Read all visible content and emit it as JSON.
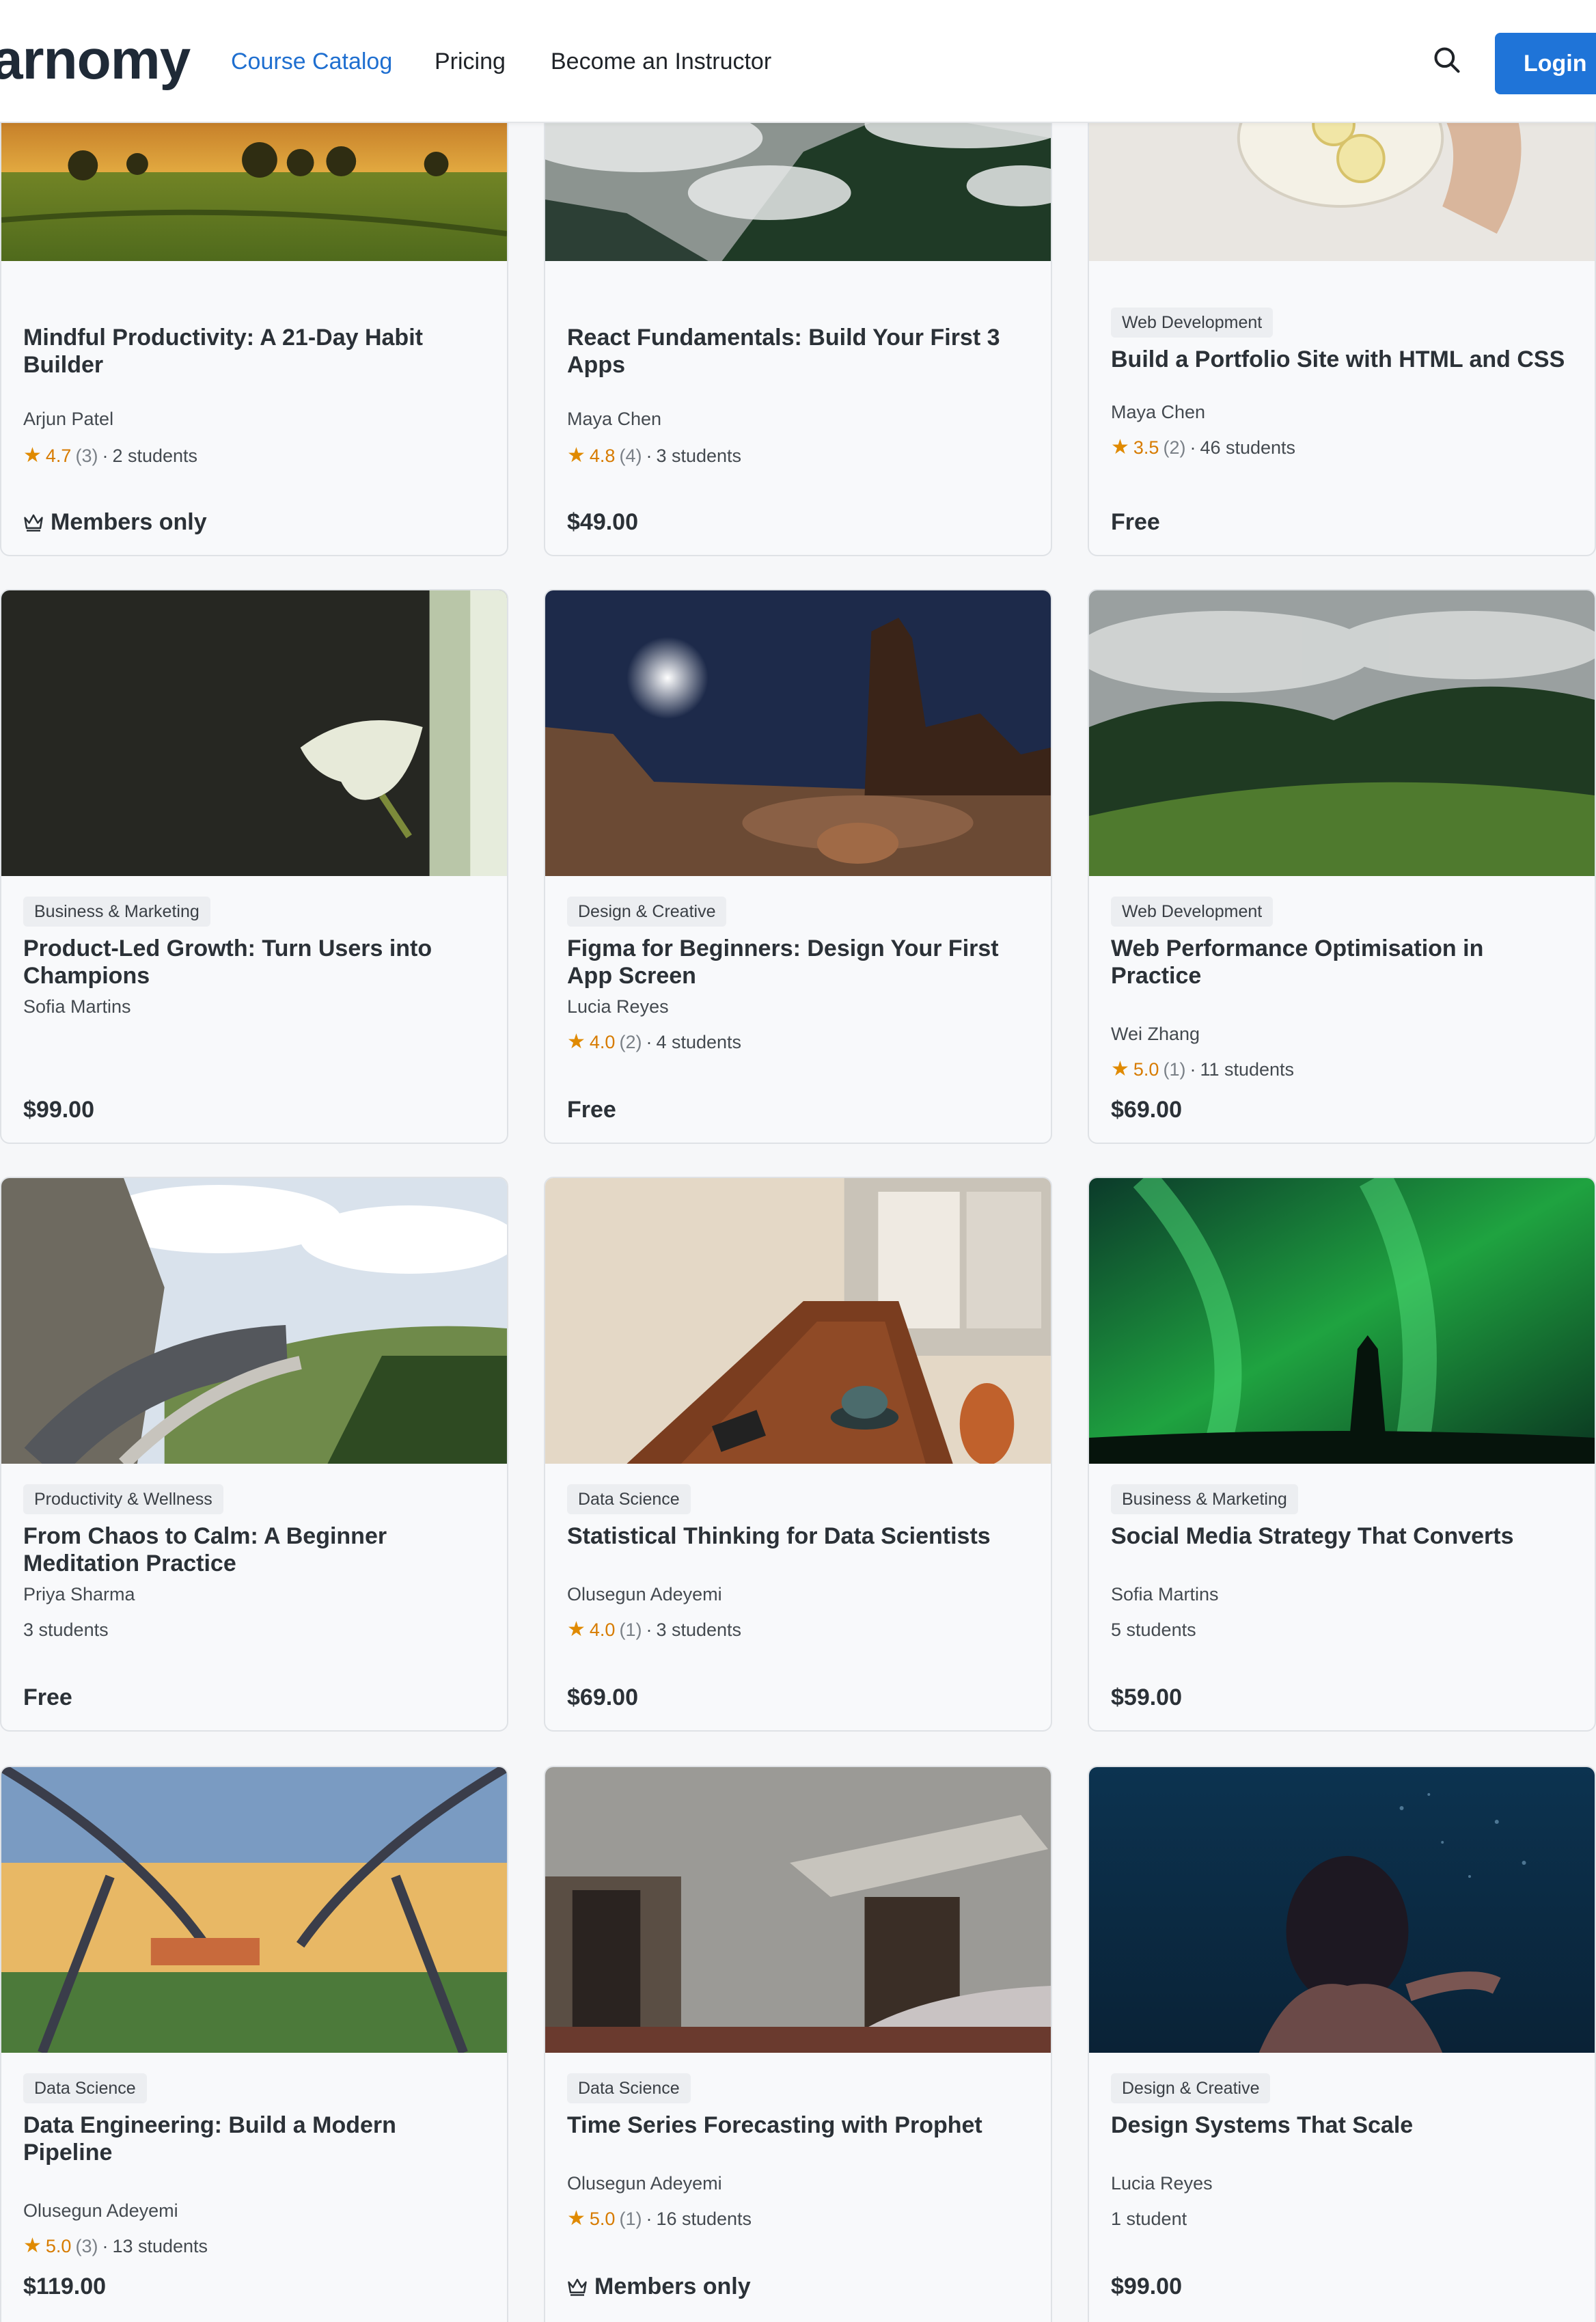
{
  "header": {
    "logo": "arnomy",
    "nav": [
      "Course Catalog",
      "Pricing",
      "Become an Instructor"
    ],
    "active_nav": "Course Catalog",
    "login_label": "Login",
    "search_icon": "search-icon"
  },
  "colors": {
    "accent": "#1f74d8",
    "rating": "#e08a00"
  },
  "courses": [
    {
      "category": "",
      "title": "Mindful Productivity: A 21-Day Habit Builder",
      "instructor": "Arjun Patel",
      "rating": "4.7",
      "ratings_count": "(3)",
      "students": "2 students",
      "price": "Members only",
      "members_icon": "crown-icon"
    },
    {
      "category": "",
      "title": "React Fundamentals: Build Your First 3 Apps",
      "instructor": "Maya Chen",
      "rating": "4.8",
      "ratings_count": "(4)",
      "students": "3 students",
      "price": "$49.00"
    },
    {
      "category": "Web Development",
      "title": "Build a Portfolio Site with HTML and CSS",
      "instructor": "Maya Chen",
      "rating": "3.5",
      "ratings_count": "(2)",
      "students": "46 students",
      "price": "Free"
    },
    {
      "category": "Business & Marketing",
      "title": "Product-Led Growth: Turn Users into Champions",
      "instructor": "Sofia Martins",
      "rating": "",
      "ratings_count": "",
      "students": "",
      "price": "$99.00"
    },
    {
      "category": "Design & Creative",
      "title": "Figma for Beginners: Design Your First App Screen",
      "instructor": "Lucia Reyes",
      "rating": "4.0",
      "ratings_count": "(2)",
      "students": "4 students",
      "price": "Free"
    },
    {
      "category": "Web Development",
      "title": "Web Performance Optimisation in Practice",
      "instructor": "Wei Zhang",
      "rating": "5.0",
      "ratings_count": "(1)",
      "students": "11 students",
      "price": "$69.00"
    },
    {
      "category": "Productivity & Wellness",
      "title": "From Chaos to Calm: A Beginner Meditation Practice",
      "instructor": "Priya Sharma",
      "rating": "",
      "ratings_count": "",
      "students": "3 students",
      "price": "Free"
    },
    {
      "category": "Data Science",
      "title": "Statistical Thinking for Data Scientists",
      "instructor": "Olusegun Adeyemi",
      "rating": "4.0",
      "ratings_count": "(1)",
      "students": "3 students",
      "price": "$69.00"
    },
    {
      "category": "Business & Marketing",
      "title": "Social Media Strategy That Converts",
      "instructor": "Sofia Martins",
      "rating": "",
      "ratings_count": "",
      "students": "5 students",
      "price": "$59.00"
    },
    {
      "category": "Data Science",
      "title": "Data Engineering: Build a Modern Pipeline",
      "instructor": "Olusegun Adeyemi",
      "rating": "5.0",
      "ratings_count": "(3)",
      "students": "13 students",
      "price": "$119.00"
    },
    {
      "category": "Data Science",
      "title": "Time Series Forecasting with Prophet",
      "instructor": "Olusegun Adeyemi",
      "rating": "5.0",
      "ratings_count": "(1)",
      "students": "16 students",
      "price": "Members only",
      "members_icon": "crown-icon"
    },
    {
      "category": "Design & Creative",
      "title": "Design Systems That Scale",
      "instructor": "Lucia Reyes",
      "rating": "",
      "ratings_count": "",
      "students": "1 student",
      "price": "$99.00"
    }
  ]
}
